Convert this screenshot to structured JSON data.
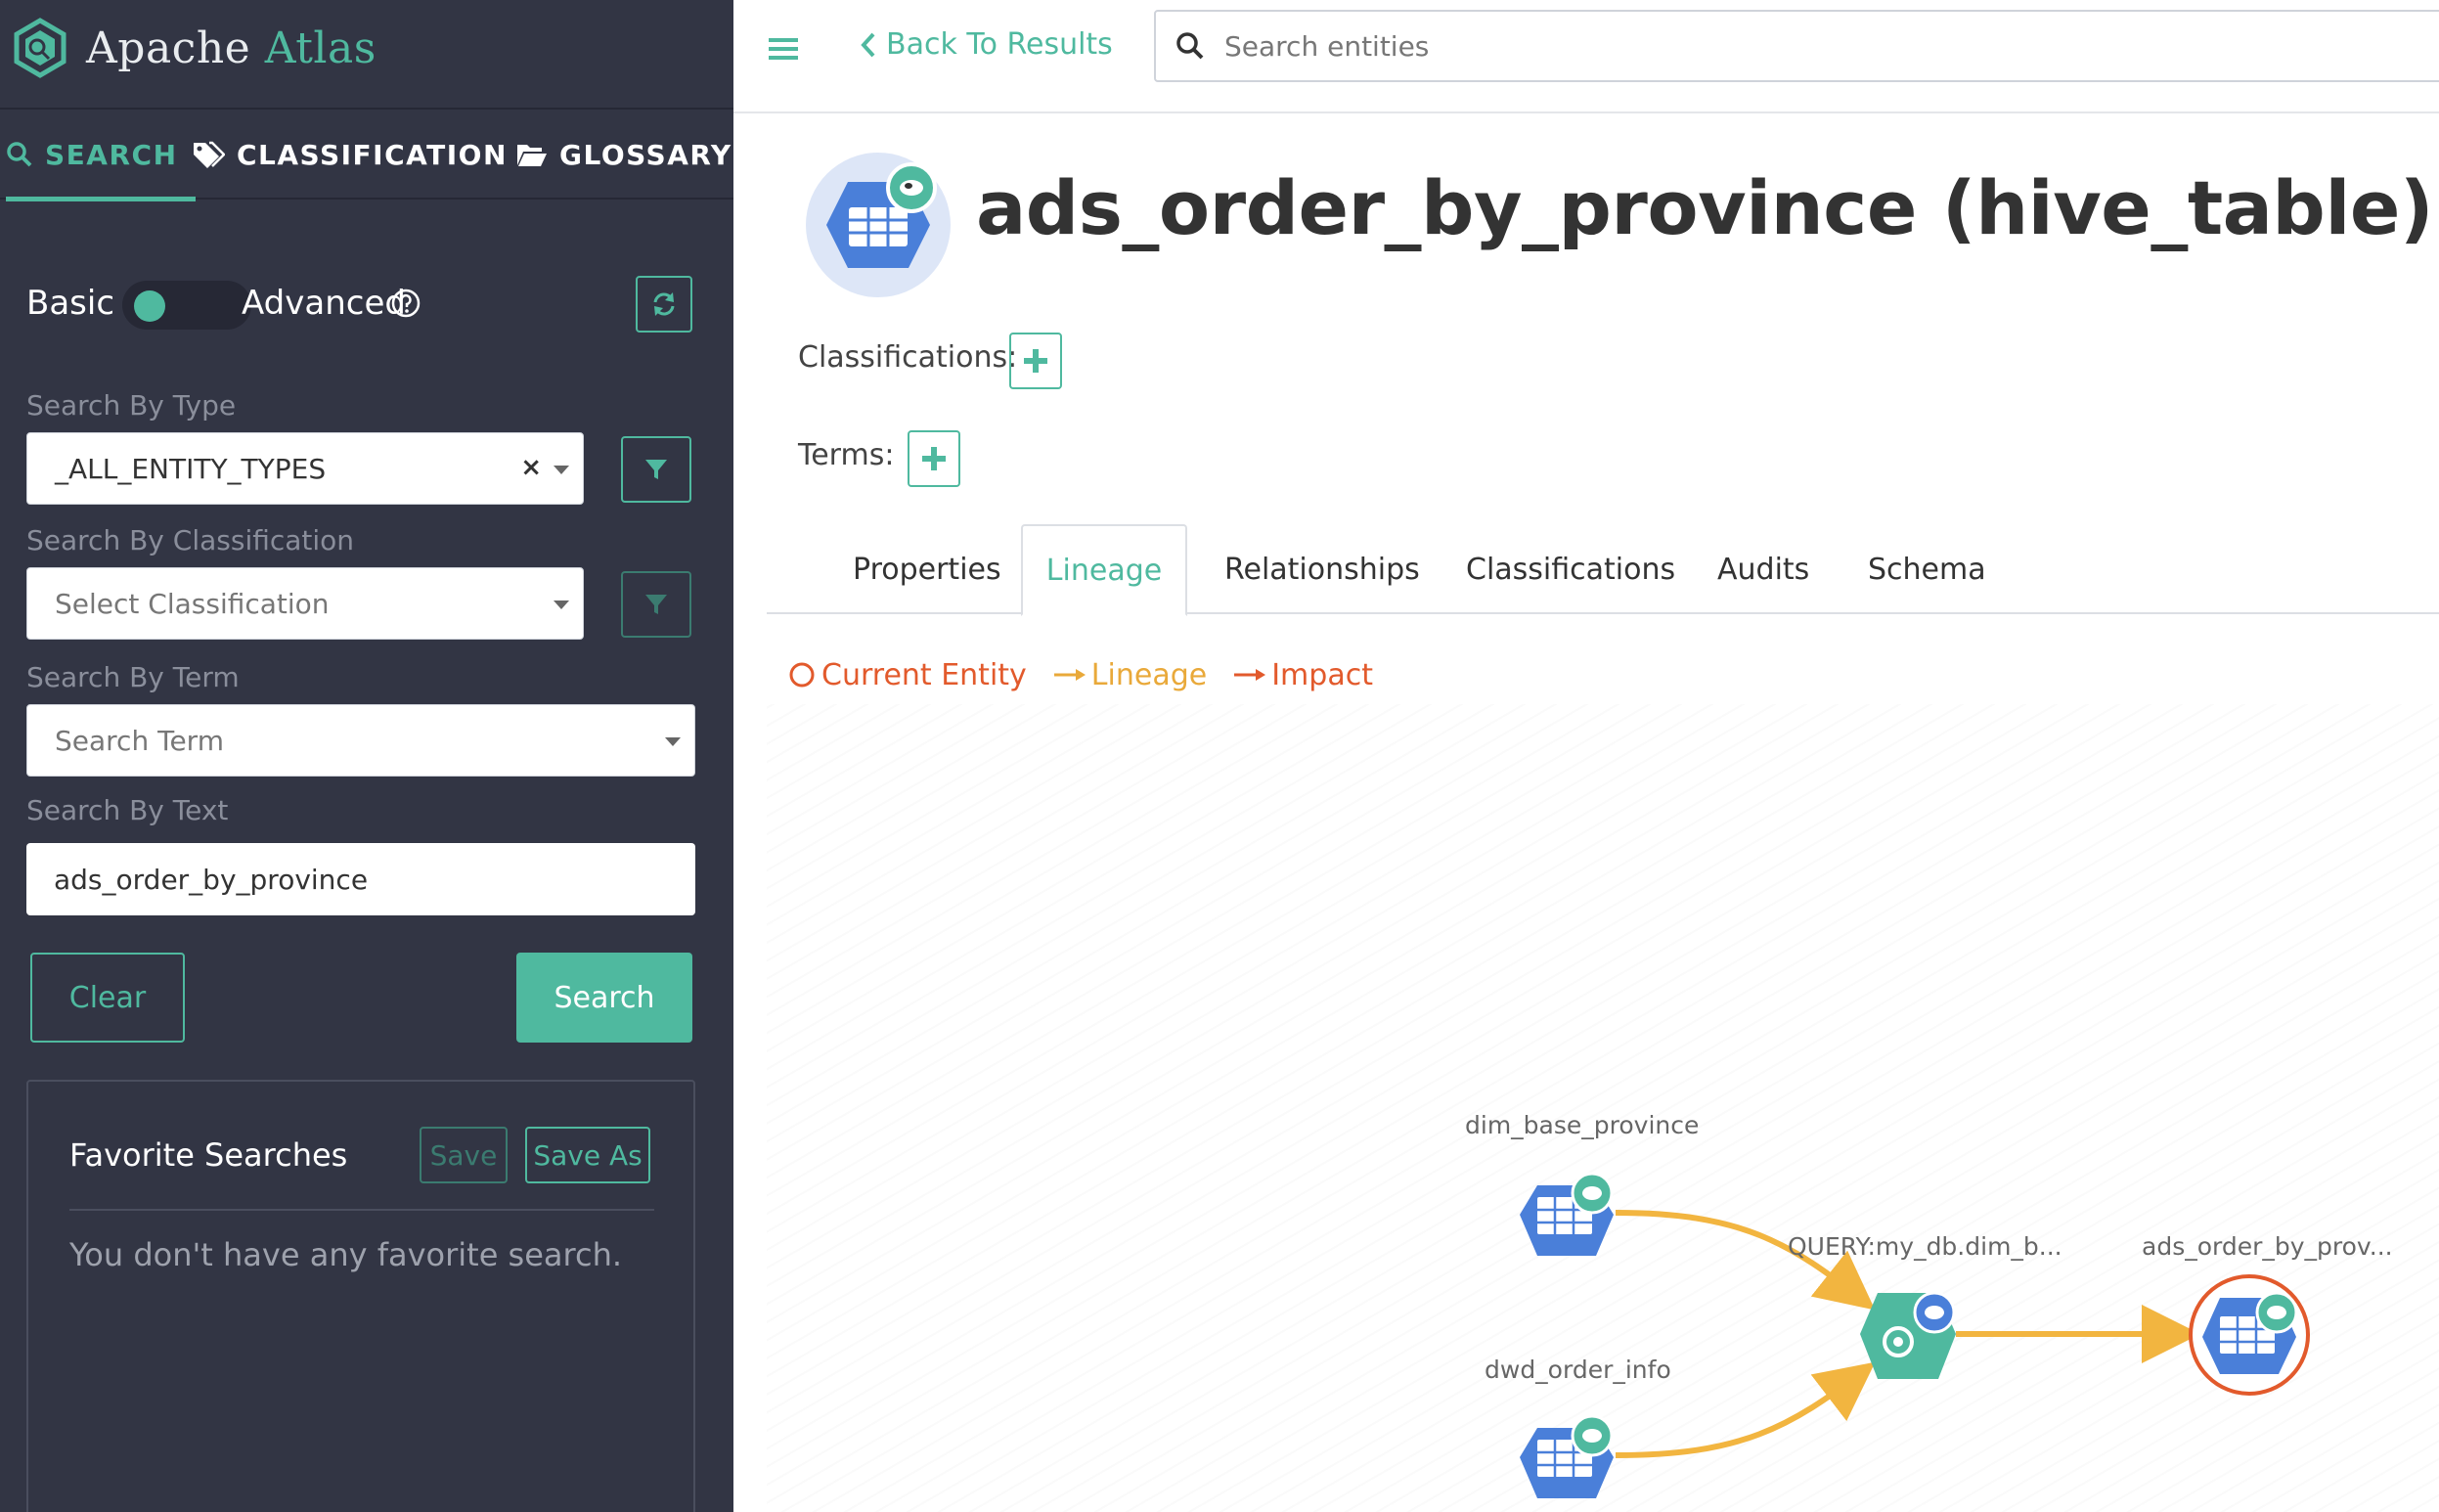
{
  "app": {
    "brand_first": "Apache",
    "brand_second": "Atlas",
    "accent_color": "#4fb99f",
    "sidebar_color": "#323544"
  },
  "sidebar": {
    "tabs": [
      {
        "label": "SEARCH",
        "icon": "search-icon",
        "active": true
      },
      {
        "label": "CLASSIFICATION",
        "icon": "tags-icon",
        "active": false
      },
      {
        "label": "GLOSSARY",
        "icon": "folder-open-icon",
        "active": false
      }
    ],
    "mode": {
      "basic_label": "Basic",
      "advanced_label": "Advanced",
      "advanced_enabled": false
    },
    "search_by_type": {
      "label": "Search By Type",
      "value": "_ALL_ENTITY_TYPES"
    },
    "search_by_classification": {
      "label": "Search By Classification",
      "placeholder": "Select Classification"
    },
    "search_by_term": {
      "label": "Search By Term",
      "placeholder": "Search Term"
    },
    "search_by_text": {
      "label": "Search By Text",
      "value": "ads_order_by_province"
    },
    "clear_label": "Clear",
    "search_label": "Search",
    "favorites": {
      "title": "Favorite Searches",
      "save_label": "Save",
      "save_as_label": "Save As",
      "empty_text": "You don't have any favorite search."
    }
  },
  "topbar": {
    "back_label": "Back To Results",
    "search_placeholder": "Search entities"
  },
  "entity": {
    "title": "ads_order_by_province (hive_table)",
    "classifications_label": "Classifications:",
    "terms_label": "Terms:"
  },
  "tabs": [
    {
      "label": "Properties",
      "active": false
    },
    {
      "label": "Lineage",
      "active": true
    },
    {
      "label": "Relationships",
      "active": false
    },
    {
      "label": "Classifications",
      "active": false
    },
    {
      "label": "Audits",
      "active": false
    },
    {
      "label": "Schema",
      "active": false
    }
  ],
  "lineage": {
    "legend": [
      {
        "label": "Current Entity",
        "color": "#e25a2c"
      },
      {
        "label": "Lineage",
        "color": "#e9a93a"
      },
      {
        "label": "Impact",
        "color": "#e25a2c"
      }
    ],
    "nodes": [
      {
        "label": "dim_base_province",
        "kind": "table"
      },
      {
        "label": "dwd_order_info",
        "kind": "table"
      },
      {
        "label": "QUERY:my_db.dim_b...",
        "kind": "process"
      },
      {
        "label": "ads_order_by_prov...",
        "kind": "table",
        "current": true
      }
    ],
    "edge_color": "#f2b540"
  }
}
